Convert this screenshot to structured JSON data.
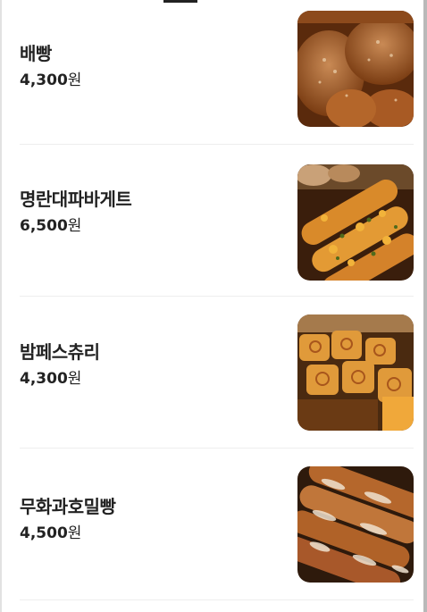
{
  "menu": {
    "items": [
      {
        "name": "배빵",
        "price": "4,300",
        "currency": "원",
        "photo": "bread-photo-1"
      },
      {
        "name": "명란대파바게트",
        "price": "6,500",
        "currency": "원",
        "photo": "bread-photo-2"
      },
      {
        "name": "밤페스츄리",
        "price": "4,300",
        "currency": "원",
        "photo": "bread-photo-3"
      },
      {
        "name": "무화과호밀빵",
        "price": "4,500",
        "currency": "원",
        "photo": "bread-photo-4"
      }
    ]
  },
  "colors": {
    "text": "#222222",
    "divider": "#eeeeee",
    "scrollbar": "#b9b9b9"
  }
}
